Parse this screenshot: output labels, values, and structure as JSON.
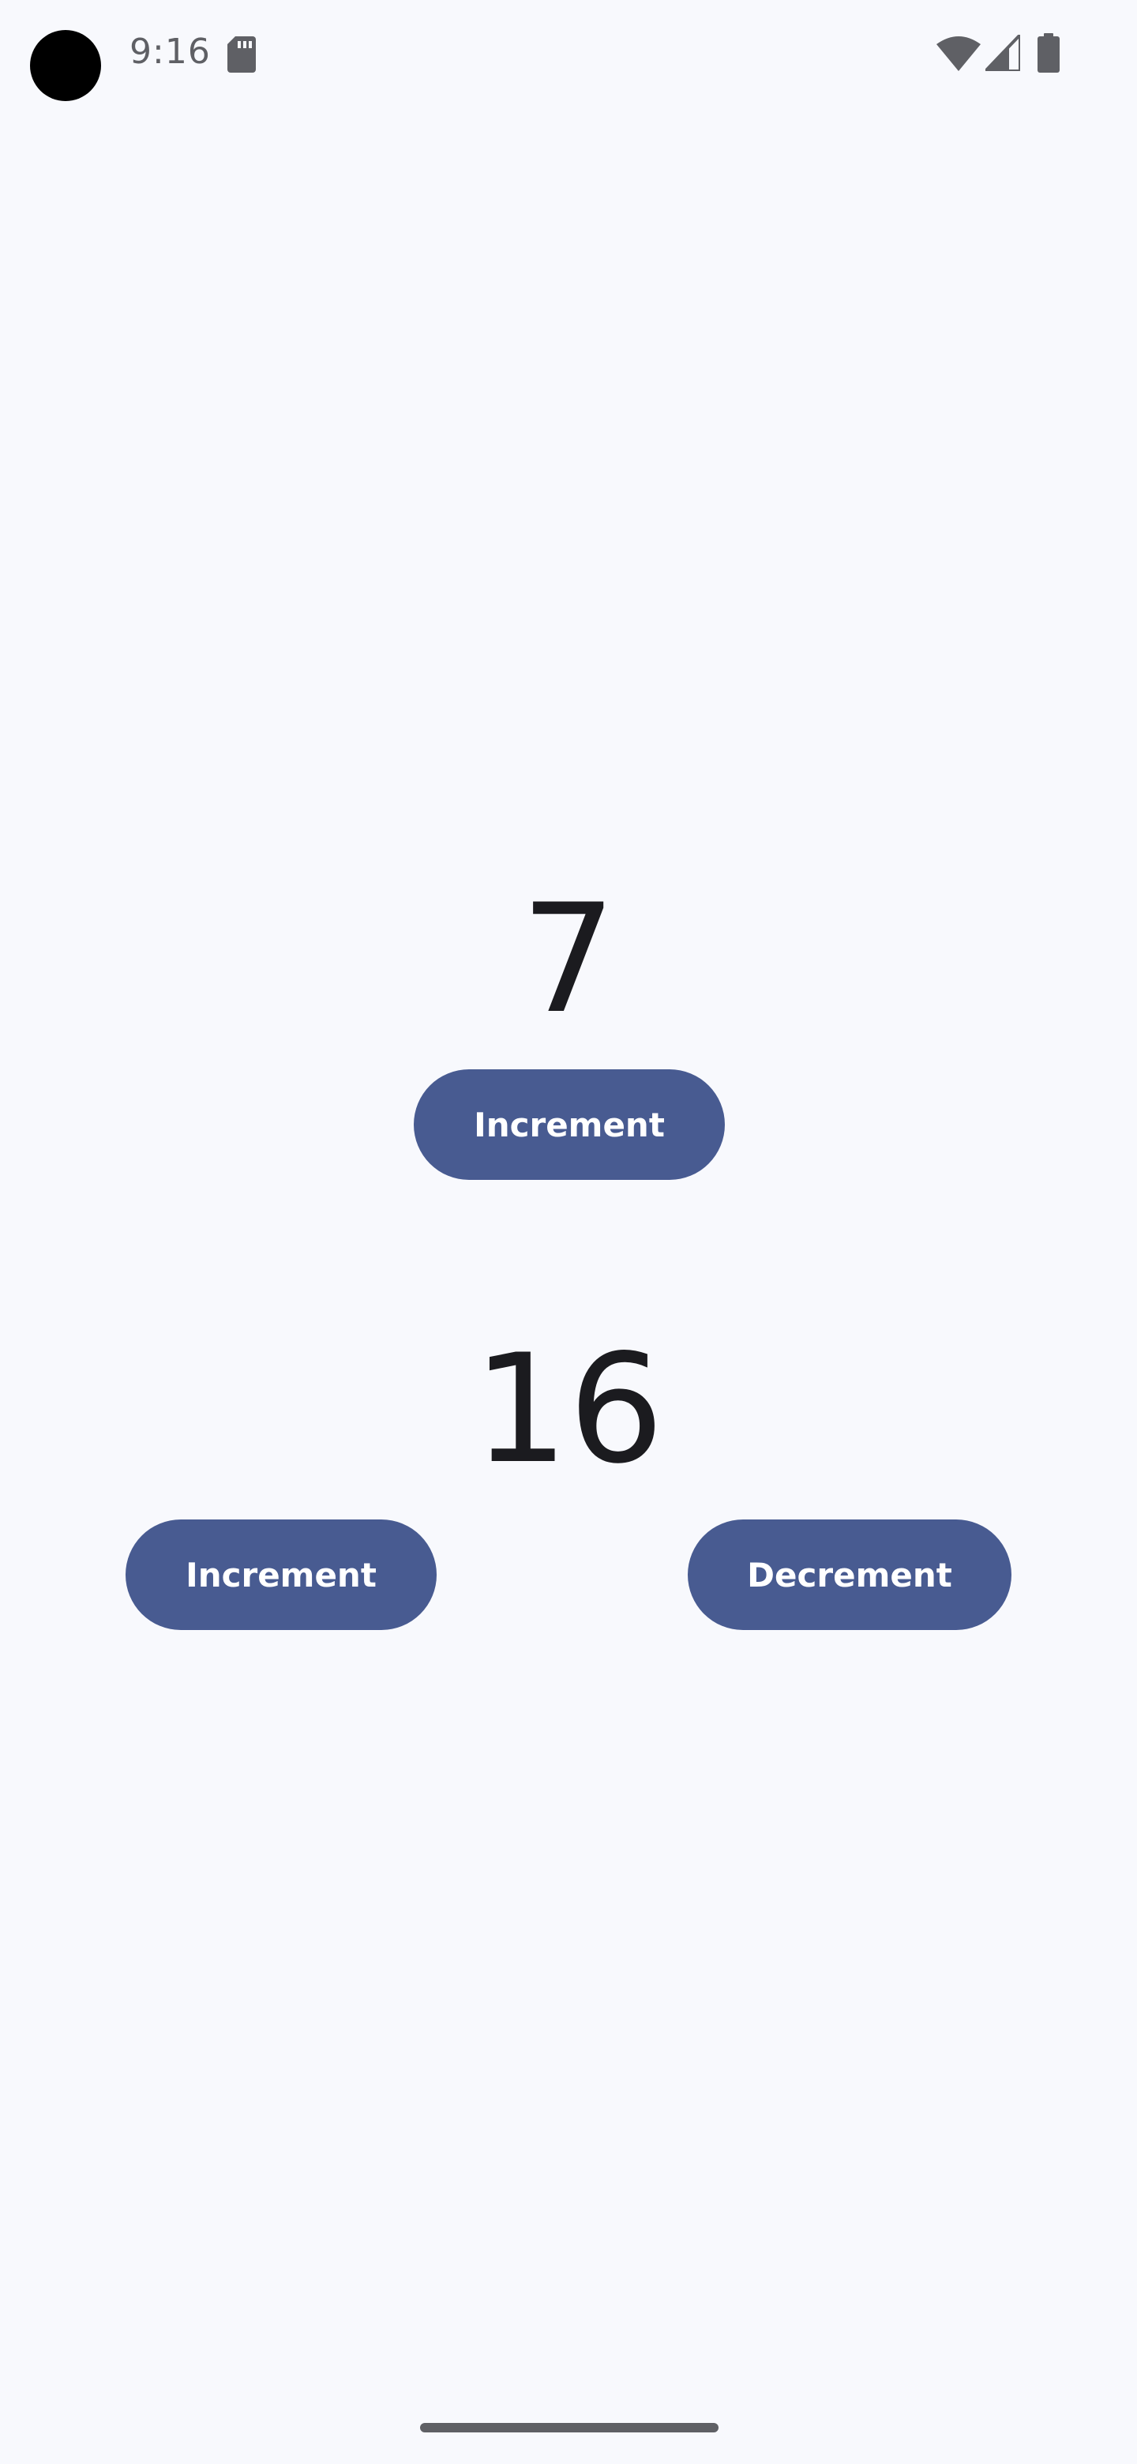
{
  "status_bar": {
    "time": "9:16",
    "icons": [
      "sd-card-icon",
      "wifi-icon",
      "cell-signal-icon",
      "battery-icon"
    ],
    "icon_color": "#5f6065"
  },
  "counter_a": {
    "value": "7",
    "increment_label": "Increment"
  },
  "counter_b": {
    "value": "16",
    "increment_label": "Increment",
    "decrement_label": "Decrement"
  },
  "theme": {
    "background": "#f8f9fd",
    "button_color": "#485b91",
    "button_text_color": "#ffffff",
    "text_color": "#1b1b1f"
  }
}
